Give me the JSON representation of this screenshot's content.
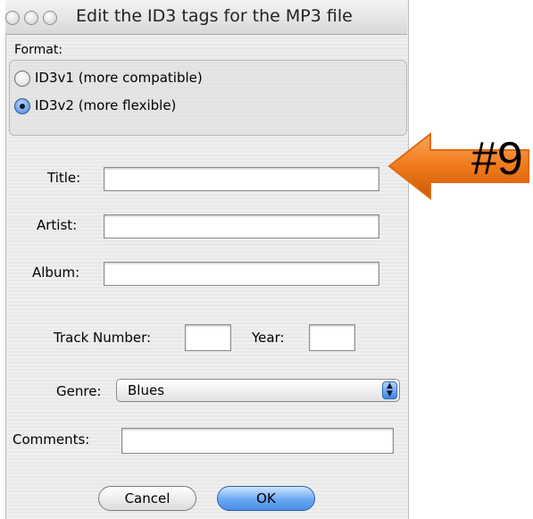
{
  "window": {
    "title": "Edit the ID3 tags for the MP3 file",
    "traffic_lights": [
      "close",
      "minimize",
      "zoom"
    ]
  },
  "format_group": {
    "label": "Format:",
    "options": [
      {
        "label": "ID3v1 (more compatible)",
        "selected": false
      },
      {
        "label": "ID3v2 (more flexible)",
        "selected": true
      }
    ]
  },
  "fields": {
    "title": {
      "label": "Title:",
      "value": ""
    },
    "artist": {
      "label": "Artist:",
      "value": ""
    },
    "album": {
      "label": "Album:",
      "value": ""
    },
    "track_number": {
      "label": "Track Number:",
      "value": ""
    },
    "year": {
      "label": "Year:",
      "value": ""
    },
    "comments": {
      "label": "Comments:",
      "value": ""
    }
  },
  "genre": {
    "label": "Genre:",
    "selected": "Blues"
  },
  "buttons": {
    "cancel": "Cancel",
    "ok": "OK"
  },
  "annotation": {
    "text": "#9",
    "arrow_color": "#f07a1a"
  }
}
